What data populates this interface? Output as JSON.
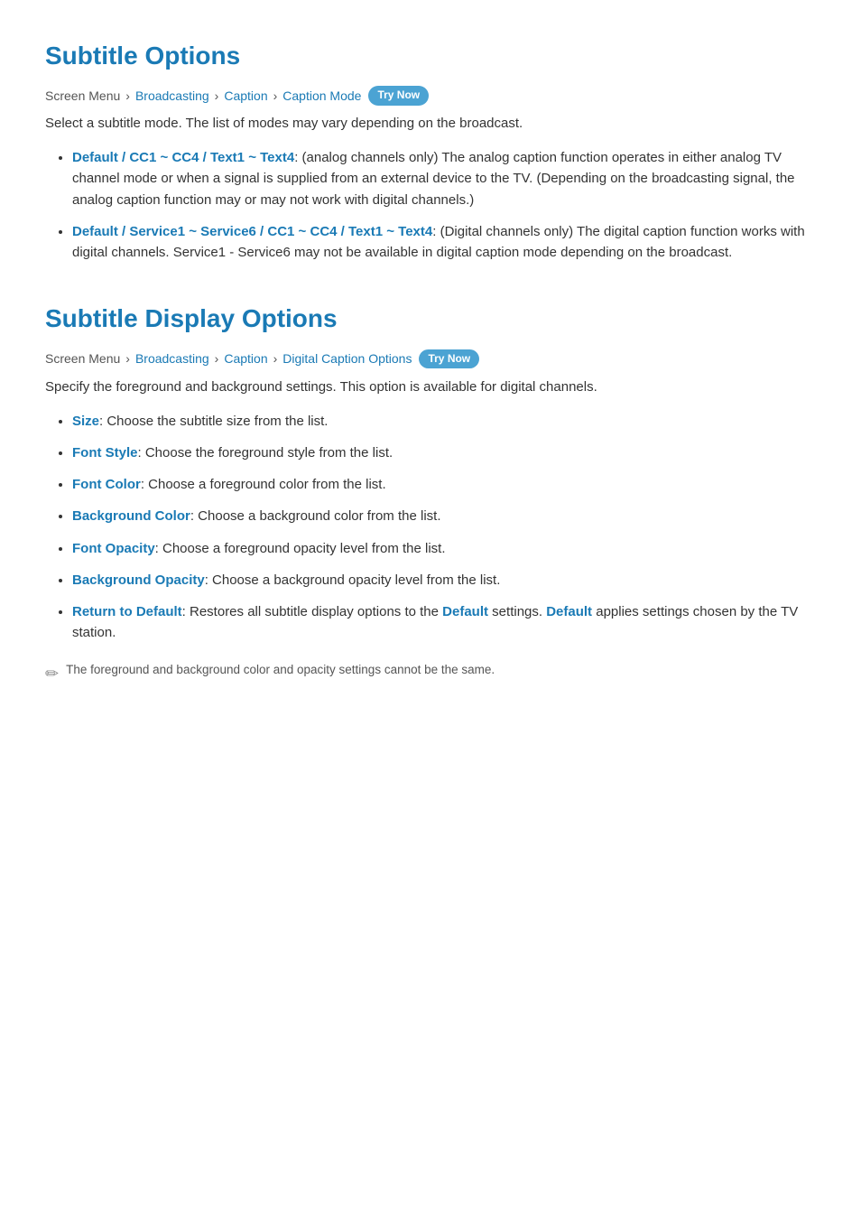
{
  "section1": {
    "title": "Subtitle Options",
    "breadcrumb": {
      "prefix": "Screen Menu",
      "items": [
        "Broadcasting",
        "Caption",
        "Caption Mode"
      ],
      "trynow": "Try Now"
    },
    "description": "Select a subtitle mode. The list of modes may vary depending on the broadcast.",
    "items": [
      {
        "id": "item1",
        "highlights": [
          "Default",
          "CC1",
          "CC4",
          "Text1",
          "Text4"
        ],
        "text": ": (analog channels only) The analog caption function operates in either analog TV channel mode or when a signal is supplied from an external device to the TV. (Depending on the broadcasting signal, the analog caption function may or may not work with digital channels.)",
        "prefix": "Default / CC1 ~ CC4 / Text1 ~ Text4"
      },
      {
        "id": "item2",
        "highlights": [
          "Default",
          "Service1",
          "Service6",
          "CC1",
          "CC4",
          "Text1",
          "Text4"
        ],
        "text": ": (Digital channels only) The digital caption function works with digital channels. Service1 - Service6 may not be available in digital caption mode depending on the broadcast.",
        "prefix": "Default / Service1 ~ Service6 / CC1 ~ CC4 / Text1 ~ Text4"
      }
    ]
  },
  "section2": {
    "title": "Subtitle Display Options",
    "breadcrumb": {
      "prefix": "Screen Menu",
      "items": [
        "Broadcasting",
        "Caption",
        "Digital Caption Options"
      ],
      "trynow": "Try Now"
    },
    "description": "Specify the foreground and background settings. This option is available for digital channels.",
    "items": [
      {
        "label": "Size",
        "text": ": Choose the subtitle size from the list."
      },
      {
        "label": "Font Style",
        "text": ": Choose the foreground style from the list."
      },
      {
        "label": "Font Color",
        "text": ": Choose a foreground color from the list."
      },
      {
        "label": "Background Color",
        "text": ": Choose a background color from the list."
      },
      {
        "label": "Font Opacity",
        "text": ": Choose a foreground opacity level from the list."
      },
      {
        "label": "Background Opacity",
        "text": ": Choose a background opacity level from the list."
      },
      {
        "label": "Return to Default",
        "text": ": Restores all subtitle display options to the ",
        "mid_highlight": "Default",
        "text2": " settings. ",
        "mid_highlight2": "Default",
        "text3": " applies settings chosen by the TV station."
      }
    ],
    "note": "The foreground and background color and opacity settings cannot be the same."
  }
}
